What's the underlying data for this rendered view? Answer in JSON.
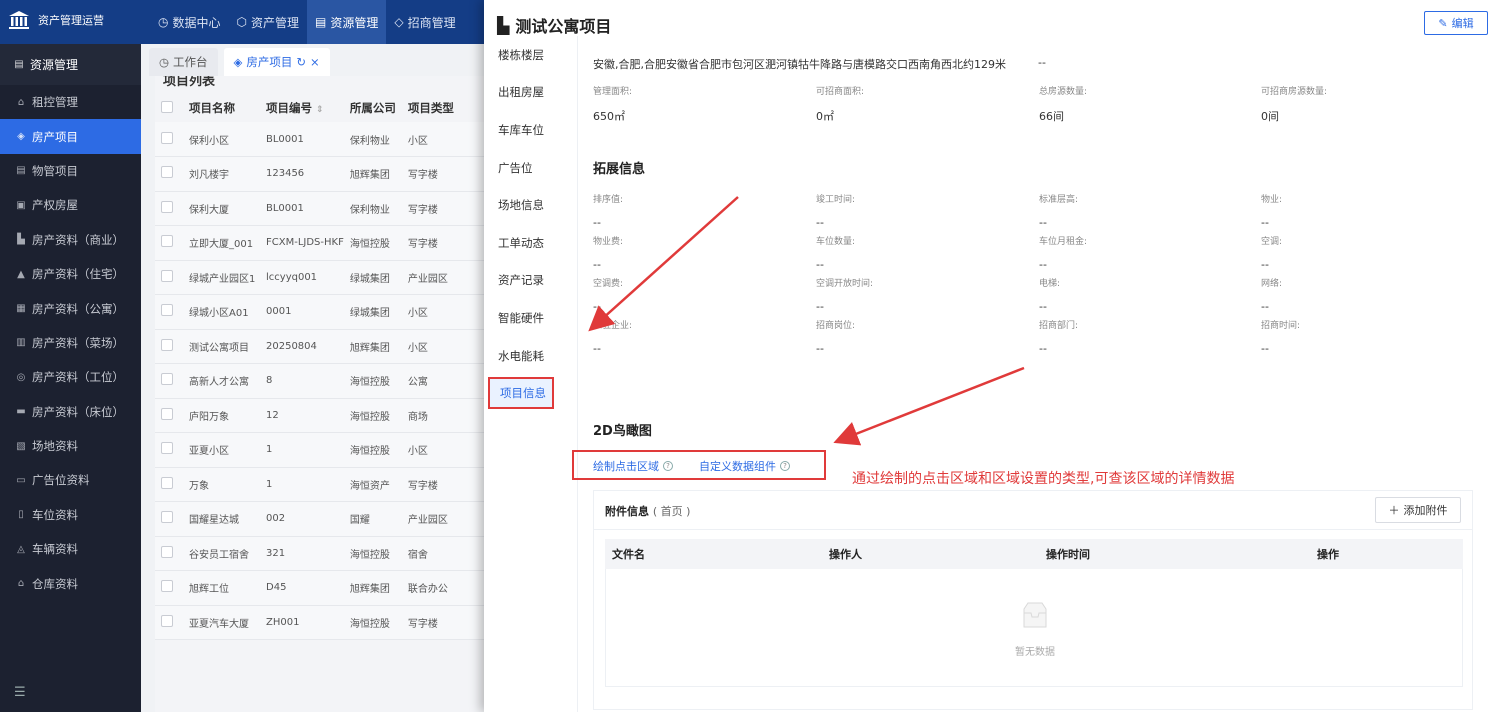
{
  "app": {
    "title": "资产管理运营"
  },
  "topnav": [
    {
      "label": "数据中心",
      "icon": "clock-icon"
    },
    {
      "label": "资产管理",
      "icon": "cube-icon"
    },
    {
      "label": "资源管理",
      "icon": "building-icon"
    },
    {
      "label": "招商管理",
      "icon": "tag-icon"
    }
  ],
  "sidebar": {
    "header": "资源管理",
    "items": [
      "租控管理",
      "房产项目",
      "物管项目",
      "产权房屋",
      "房产资料（商业）",
      "房产资料（住宅）",
      "房产资料（公寓）",
      "房产资料（菜场）",
      "房产资料（工位）",
      "房产资料（床位）",
      "场地资料",
      "广告位资料",
      "车位资料",
      "车辆资料",
      "仓库资料"
    ],
    "active": "房产项目"
  },
  "tabs": {
    "workbench": "工作台",
    "project": "房产项目",
    "close": "×"
  },
  "project_list": {
    "title": "项目列表",
    "columns": [
      "项目名称",
      "项目编号",
      "所属公司",
      "项目类型"
    ],
    "rows": [
      [
        "保利小区",
        "BL0001",
        "保利物业",
        "小区"
      ],
      [
        "刘凡楼宇",
        "123456",
        "旭辉集团",
        "写字楼"
      ],
      [
        "保利大厦",
        "BL0001",
        "保利物业",
        "写字楼"
      ],
      [
        "立即大厦_001",
        "FCXM-LJDS-HKF",
        "海恒控股",
        "写字楼"
      ],
      [
        "绿城产业园区1",
        "lccyyq001",
        "绿城集团",
        "产业园区"
      ],
      [
        "绿城小区A01",
        "0001",
        "绿城集团",
        "小区"
      ],
      [
        "测试公寓项目",
        "20250804",
        "旭辉集团",
        "小区"
      ],
      [
        "高新人才公寓",
        "8",
        "海恒控股",
        "公寓"
      ],
      [
        "庐阳万象",
        "12",
        "海恒控股",
        "商场"
      ],
      [
        "亚夏小区",
        "1",
        "海恒控股",
        "小区"
      ],
      [
        "万象",
        "1",
        "海恒资产",
        "写字楼"
      ],
      [
        "国耀星达城",
        "002",
        "国耀",
        "产业园区"
      ],
      [
        "谷安员工宿舍",
        "321",
        "海恒控股",
        "宿舍"
      ],
      [
        "旭辉工位",
        "D45",
        "旭辉集团",
        "联合办公"
      ],
      [
        "亚夏汽车大厦",
        "ZH001",
        "海恒控股",
        "写字楼"
      ]
    ]
  },
  "drawer": {
    "title": "测试公寓项目",
    "edit": "编辑",
    "nav": [
      "楼栋楼层",
      "出租房屋",
      "车库车位",
      "广告位",
      "场地信息",
      "工单动态",
      "资产记录",
      "智能硬件",
      "水电能耗",
      "项目信息"
    ],
    "nav_active": "项目信息",
    "address": "安徽,合肥,合肥安徽省合肥市包河区淝河镇牯牛降路与唐模路交口西南角西北约129米",
    "address2": "--",
    "area": [
      {
        "label": "管理面积:",
        "value": "650㎡"
      },
      {
        "label": "可招商面积:",
        "value": "0㎡"
      },
      {
        "label": "总房源数量:",
        "value": "66间"
      },
      {
        "label": "可招商房源数量:",
        "value": "0间"
      }
    ],
    "ext_title": "拓展信息",
    "ext": [
      {
        "label": "排序值:",
        "value": "--"
      },
      {
        "label": "竣工时间:",
        "value": "--"
      },
      {
        "label": "标准层高:",
        "value": "--"
      },
      {
        "label": "物业:",
        "value": "--"
      },
      {
        "label": "物业费:",
        "value": "--"
      },
      {
        "label": "车位数量:",
        "value": "--"
      },
      {
        "label": "车位月租金:",
        "value": "--"
      },
      {
        "label": "空调:",
        "value": "--"
      },
      {
        "label": "空调费:",
        "value": "--"
      },
      {
        "label": "空调开放时间:",
        "value": "--"
      },
      {
        "label": "电梯:",
        "value": "--"
      },
      {
        "label": "网络:",
        "value": "--"
      },
      {
        "label": "入驻企业:",
        "value": "--"
      },
      {
        "label": "招商岗位:",
        "value": "--"
      },
      {
        "label": "招商部门:",
        "value": "--"
      },
      {
        "label": "招商时间:",
        "value": "--"
      }
    ],
    "birdview_title": "2D鸟瞰图",
    "link1": "绘制点击区域",
    "link2": "自定义数据组件",
    "annotation": "通过绘制的点击区域和区域设置的类型,可查该区域的详情数据",
    "attachments": {
      "title": "附件信息",
      "sub": "( 首页 )",
      "add": "添加附件",
      "columns": [
        "文件名",
        "操作人",
        "操作时间",
        "操作"
      ],
      "empty": "暂无数据"
    }
  },
  "colors": {
    "primary": "#2d6be4",
    "topbar": "#143d86",
    "sidebar": "#1c2130",
    "annotation": "#e03a3a"
  }
}
